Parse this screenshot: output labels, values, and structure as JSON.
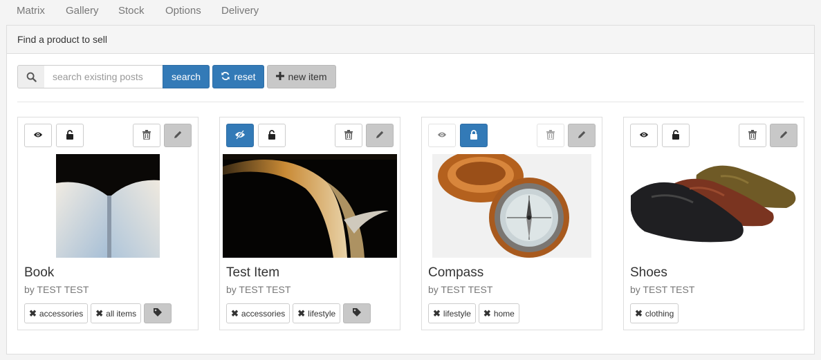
{
  "nav": {
    "tabs": [
      {
        "label": "Matrix"
      },
      {
        "label": "Gallery"
      },
      {
        "label": "Stock"
      },
      {
        "label": "Options"
      },
      {
        "label": "Delivery"
      }
    ]
  },
  "panel": {
    "heading": "Find a product to sell"
  },
  "search": {
    "placeholder": "search existing posts",
    "value": "",
    "search_label": "search",
    "reset_label": "reset",
    "new_item_label": "new item"
  },
  "colors": {
    "primary": "#337ab7",
    "grey_button": "#c8c8c8"
  },
  "products": [
    {
      "title": "Book",
      "byline": "by TEST TEST",
      "visible_toggle_active": false,
      "lock_active": false,
      "tags": [
        {
          "label": "accessories"
        },
        {
          "label": "all items"
        }
      ]
    },
    {
      "title": "Test Item",
      "byline": "by TEST TEST",
      "visible_toggle_active": true,
      "lock_active": false,
      "tags": [
        {
          "label": "accessories"
        },
        {
          "label": "lifestyle"
        }
      ]
    },
    {
      "title": "Compass",
      "byline": "by TEST TEST",
      "visible_toggle_active": false,
      "lock_active": true,
      "tags": [
        {
          "label": "lifestyle"
        },
        {
          "label": "home"
        }
      ]
    },
    {
      "title": "Shoes",
      "byline": "by TEST TEST",
      "visible_toggle_active": false,
      "lock_active": false,
      "tags": [
        {
          "label": "clothing"
        }
      ]
    }
  ]
}
